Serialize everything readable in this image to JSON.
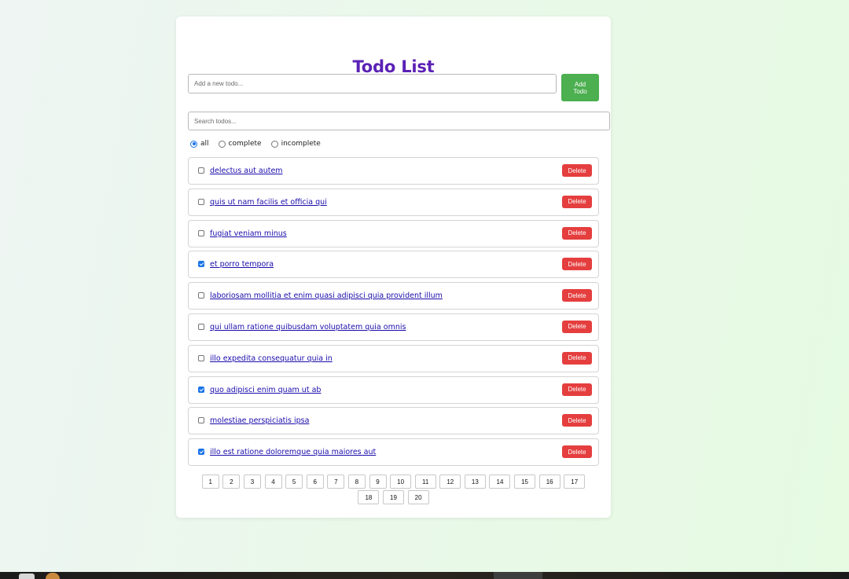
{
  "app": {
    "title": "Todo List"
  },
  "add_todo": {
    "placeholder": "Add a new todo...",
    "button_label": "Add Todo"
  },
  "search": {
    "placeholder": "Search todos..."
  },
  "filters": {
    "selected": "all",
    "options": [
      {
        "label": "all",
        "checked": true
      },
      {
        "label": "complete",
        "checked": false
      },
      {
        "label": "incomplete",
        "checked": false
      }
    ]
  },
  "todos": [
    {
      "title": "delectus aut autem",
      "completed": false,
      "delete_label": "Delete"
    },
    {
      "title": "quis ut nam facilis et officia qui",
      "completed": false,
      "delete_label": "Delete"
    },
    {
      "title": "fugiat veniam minus",
      "completed": false,
      "delete_label": "Delete"
    },
    {
      "title": "et porro tempora",
      "completed": true,
      "delete_label": "Delete"
    },
    {
      "title": "laboriosam mollitia et enim quasi adipisci quia provident illum",
      "completed": false,
      "delete_label": "Delete"
    },
    {
      "title": "qui ullam ratione quibusdam voluptatem quia omnis",
      "completed": false,
      "delete_label": "Delete"
    },
    {
      "title": "illo expedita consequatur quia in",
      "completed": false,
      "delete_label": "Delete"
    },
    {
      "title": "quo adipisci enim quam ut ab",
      "completed": true,
      "delete_label": "Delete"
    },
    {
      "title": "molestiae perspiciatis ipsa",
      "completed": false,
      "delete_label": "Delete"
    },
    {
      "title": "illo est ratione doloremque quia maiores aut",
      "completed": true,
      "delete_label": "Delete"
    }
  ],
  "pagination": {
    "pages": [
      "1",
      "2",
      "3",
      "4",
      "5",
      "6",
      "7",
      "8",
      "9",
      "10",
      "11",
      "12",
      "13",
      "14",
      "15",
      "16",
      "17",
      "18",
      "19",
      "20"
    ]
  },
  "colors": {
    "title": "#5b21b6",
    "add_button": "#4caf50",
    "delete_button": "#e53e3e",
    "link": "#1a0dab",
    "checkbox_checked": "#1a73e8"
  }
}
